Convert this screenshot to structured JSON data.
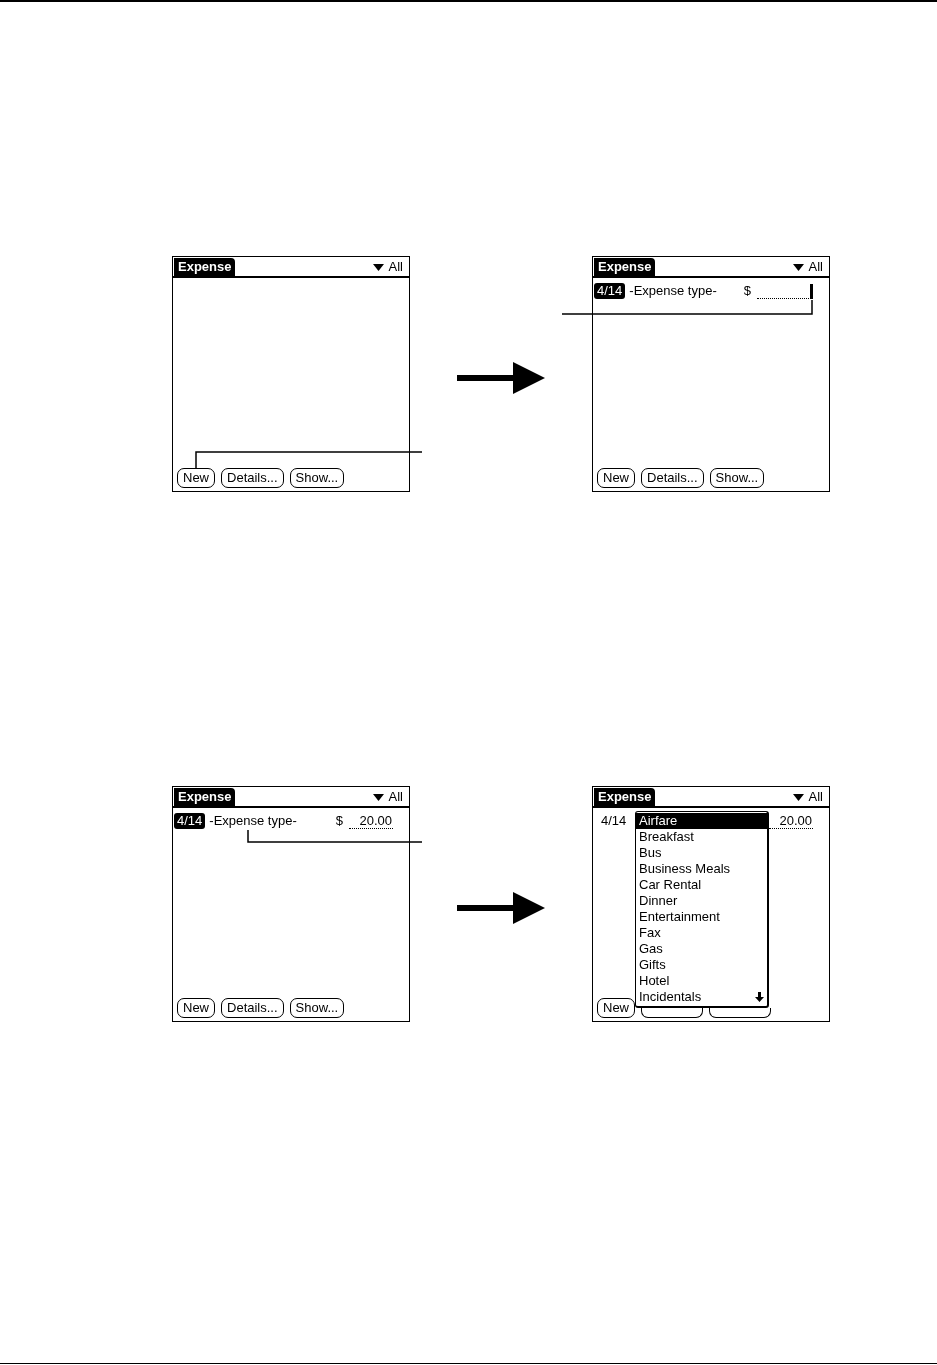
{
  "figures": [
    {
      "screens": [
        {
          "title": "Expense",
          "category": "All",
          "buttons": [
            {
              "label": "New",
              "covered": false
            },
            {
              "label": "Details...",
              "covered": false
            },
            {
              "label": "Show...",
              "covered": false
            }
          ]
        },
        {
          "title": "Expense",
          "category": "All",
          "rows": [
            {
              "date": "4/14",
              "selected": true,
              "type": "-Expense type-",
              "currency": "$",
              "cursor": true
            }
          ],
          "buttons": [
            {
              "label": "New",
              "covered": false
            },
            {
              "label": "Details...",
              "covered": false
            },
            {
              "label": "Show...",
              "covered": false
            }
          ]
        }
      ]
    },
    {
      "screens": [
        {
          "title": "Expense",
          "category": "All",
          "rows": [
            {
              "date": "4/14",
              "selected": true,
              "type": "-Expense type-",
              "currency": "$",
              "amount": "20.00",
              "cursor": false
            }
          ],
          "buttons": [
            {
              "label": "New",
              "covered": false
            },
            {
              "label": "Details...",
              "covered": false
            },
            {
              "label": "Show...",
              "covered": false
            }
          ]
        },
        {
          "title": "Expense",
          "category": "All",
          "rows": [
            {
              "date": "4/14",
              "selected": false,
              "amount": "20.00",
              "cursor": false
            }
          ],
          "popup": {
            "items": [
              {
                "label": "Airfare",
                "selected": true
              },
              {
                "label": "Breakfast",
                "selected": false
              },
              {
                "label": "Bus",
                "selected": false
              },
              {
                "label": "Business Meals",
                "selected": false
              },
              {
                "label": "Car Rental",
                "selected": false
              },
              {
                "label": "Dinner",
                "selected": false
              },
              {
                "label": "Entertainment",
                "selected": false
              },
              {
                "label": "Fax",
                "selected": false
              },
              {
                "label": "Gas",
                "selected": false
              },
              {
                "label": "Gifts",
                "selected": false
              },
              {
                "label": "Hotel",
                "selected": false
              },
              {
                "label": "Incidentals",
                "selected": false
              }
            ]
          },
          "buttons": [
            {
              "label": "New",
              "covered": false
            },
            {
              "covered": true
            },
            {
              "covered": true
            }
          ]
        }
      ]
    }
  ]
}
